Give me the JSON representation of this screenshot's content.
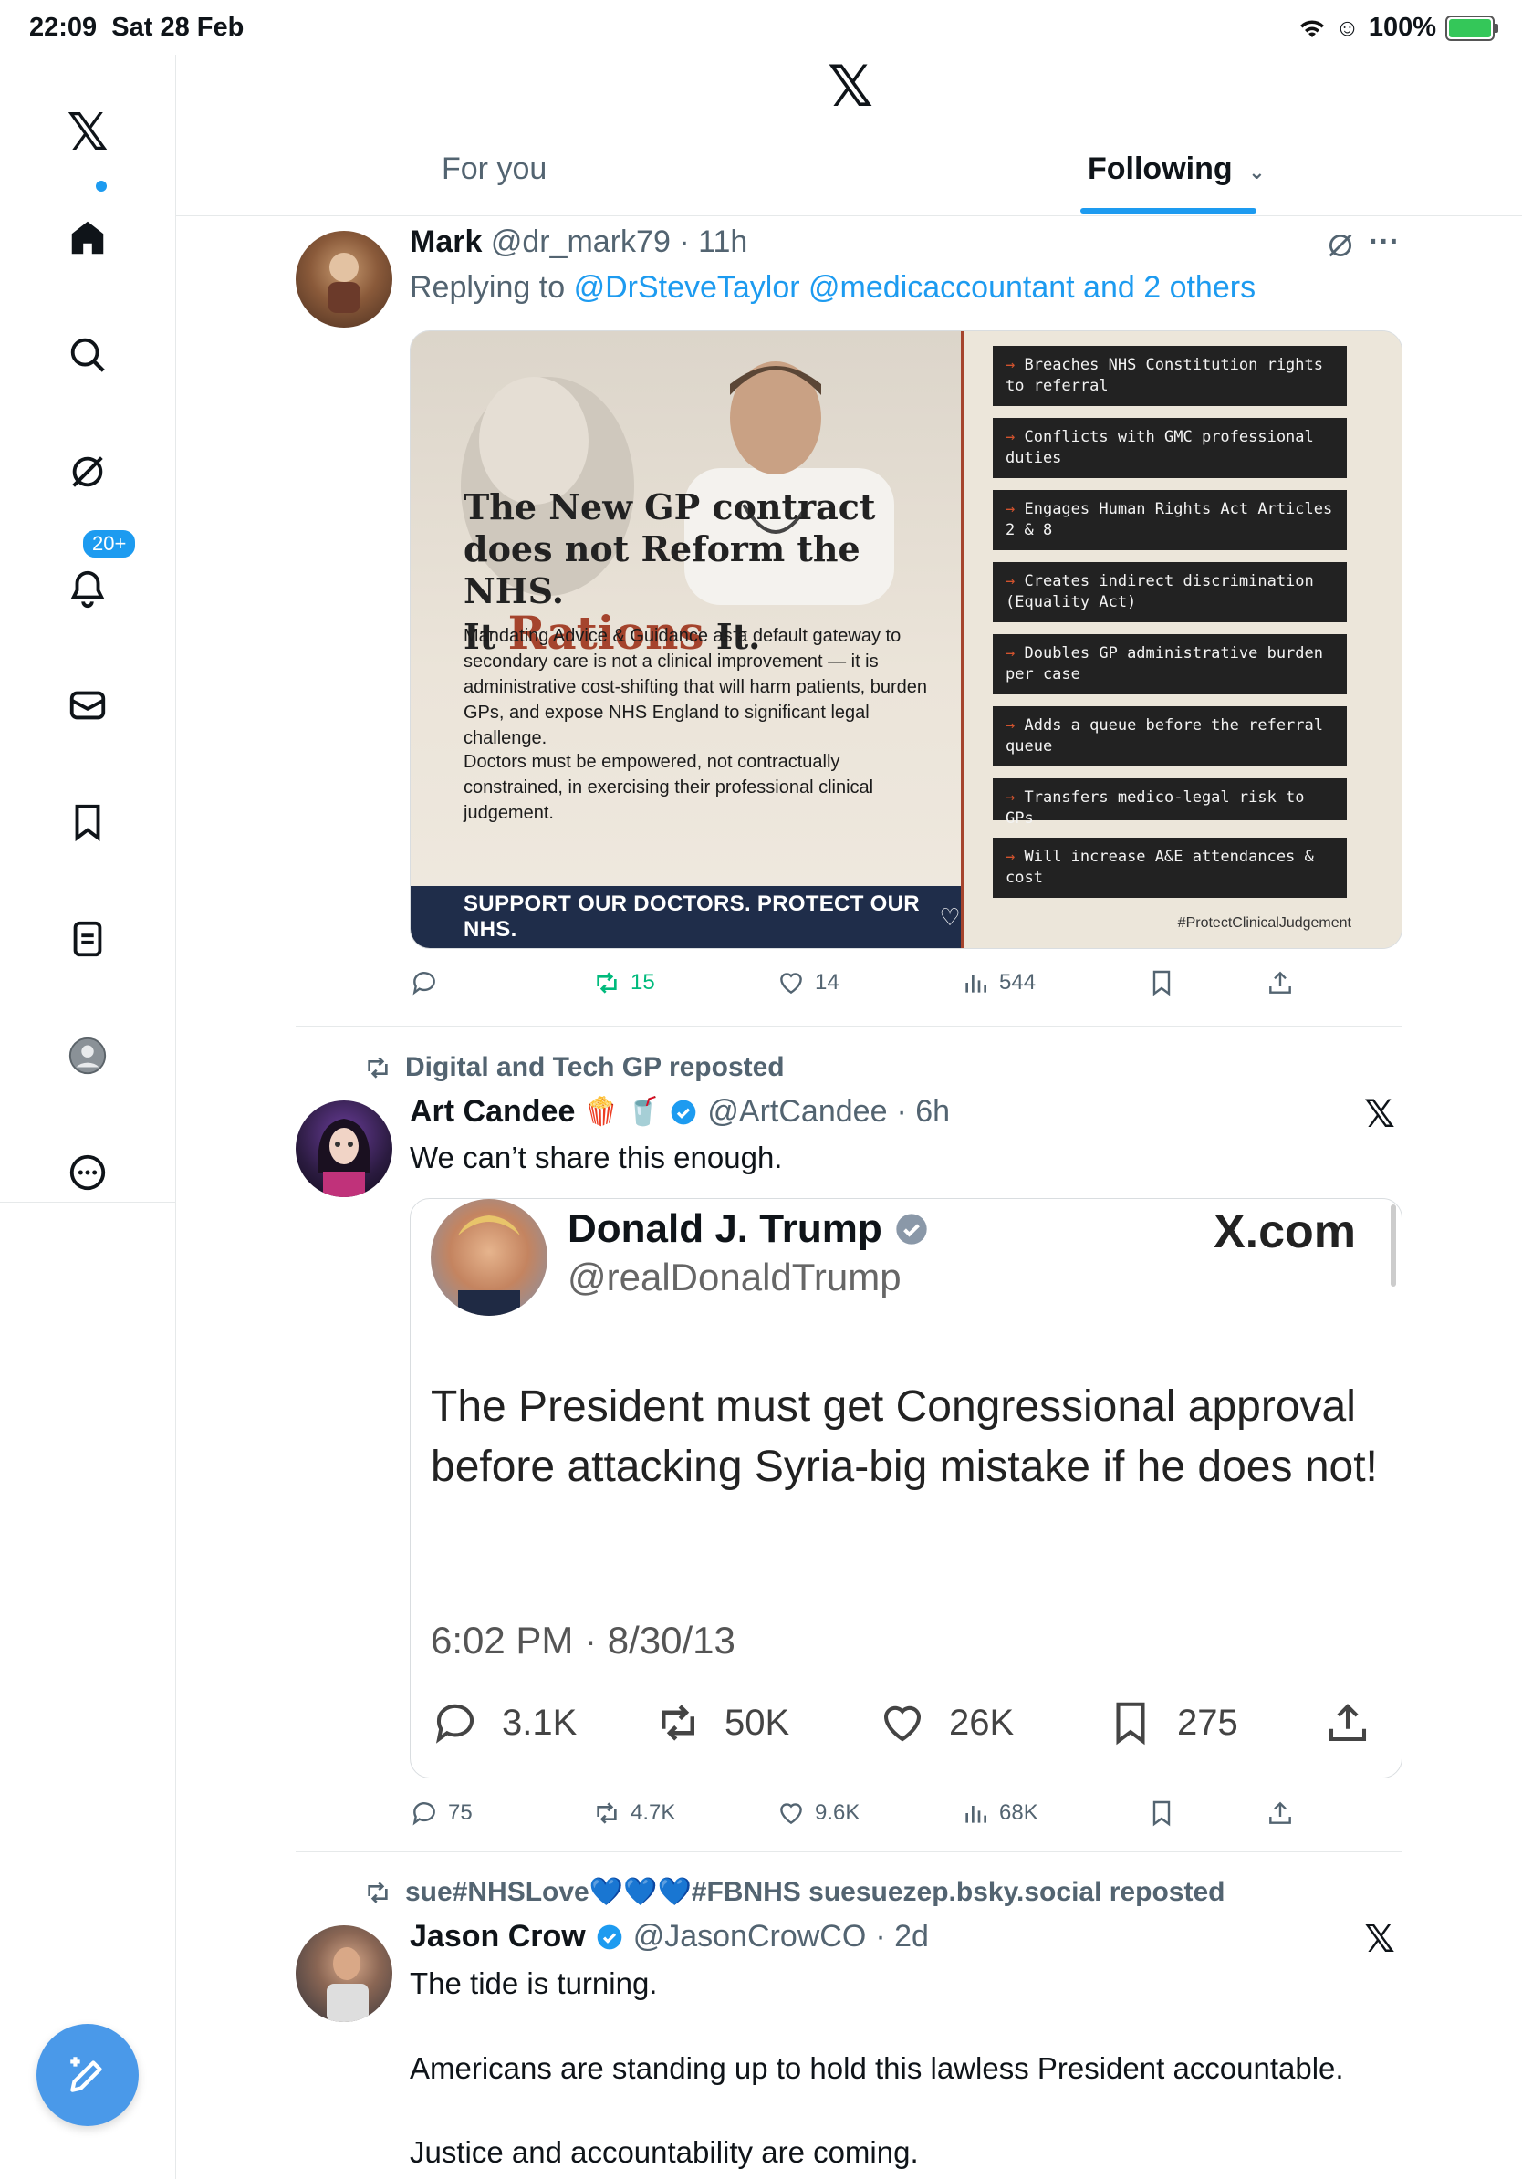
{
  "status_bar": {
    "time": "22:09",
    "date": "Sat 28 Feb",
    "battery": "100%"
  },
  "sidebar": {
    "notification_badge": "20+"
  },
  "header": {
    "logo": "𝕏"
  },
  "tabs": [
    {
      "label": "For you"
    },
    {
      "label": "Following"
    }
  ],
  "posts": [
    {
      "name": "Mark",
      "handle": "@dr_mark79",
      "time": "· 11h",
      "replying_prefix": "Replying to",
      "replying_to": "@DrSteveTaylor @medicaccountant and 2 others",
      "infographic": {
        "headline_1": "The New GP contract does not Reform the NHS.",
        "headline_2a": "It ",
        "headline_2b": "Rations",
        "headline_2c": " It.",
        "body_1": "Mandating Advice & Guidance as a default gateway to secondary care is not a clinical improvement — it is administrative cost-shifting that will harm patients, burden GPs, and expose NHS England to significant legal challenge.",
        "body_2": "Doctors must be empowered, not contractually constrained, in exercising their professional clinical judgement.",
        "banner": "SUPPORT OUR DOCTORS. PROTECT OUR NHS.",
        "hashtag": "#ProtectClinicalJudgement",
        "bullets": [
          "Breaches NHS Constitution rights to referral",
          "Conflicts with GMC professional duties",
          "Engages Human Rights Act Articles 2 & 8",
          "Creates indirect discrimination (Equality Act)",
          "Doubles GP administrative burden per case",
          "Adds a queue before the referral queue",
          "Transfers medico-legal risk to GPs",
          "Will increase A&E attendances & cost"
        ]
      },
      "stats": {
        "replies": "",
        "reposts": "15",
        "likes": "14",
        "views": "544"
      }
    },
    {
      "repost_label": "Digital and Tech GP reposted",
      "name": "Art Candee",
      "emoji": "🍿 🥤",
      "handle": "@ArtCandee",
      "time": "· 6h",
      "text": "We can’t share this enough.",
      "quote": {
        "name": "Donald J. Trump",
        "handle": "@realDonaldTrump",
        "brand": "X.com",
        "text": "The President must get Congressional approval before attacking Syria-big mistake if he does not!",
        "date": "6:02 PM · 8/30/13",
        "replies": "3.1K",
        "reposts": "50K",
        "likes": "26K",
        "bookmarks": "275"
      },
      "stats": {
        "replies": "75",
        "reposts": "4.7K",
        "likes": "9.6K",
        "views": "68K"
      }
    },
    {
      "repost_label": "sue#NHSLove💙💙💙#FBNHS suesuezep.bsky.social reposted",
      "name": "Jason Crow",
      "handle": "@JasonCrowCO",
      "time": "· 2d",
      "lines": [
        "The tide is turning.",
        "Americans are standing up to hold this lawless President accountable.",
        "Justice and accountability are coming."
      ]
    }
  ],
  "colors": {
    "accent": "#1d9bf0",
    "repost_green": "#00ba7c",
    "muted": "#536471",
    "banner_navy": "#1f2d4a",
    "headline_red": "#a5442d"
  },
  "icons": [
    "x-logo-icon",
    "home-icon",
    "search-icon",
    "grok-icon",
    "bell-icon",
    "mail-icon",
    "bookmark-icon",
    "lists-icon",
    "profile-icon",
    "more-icon",
    "compose-icon",
    "reply-icon",
    "repost-icon",
    "like-icon",
    "views-icon",
    "share-icon",
    "verified-icon",
    "wifi-icon",
    "battery-icon"
  ]
}
